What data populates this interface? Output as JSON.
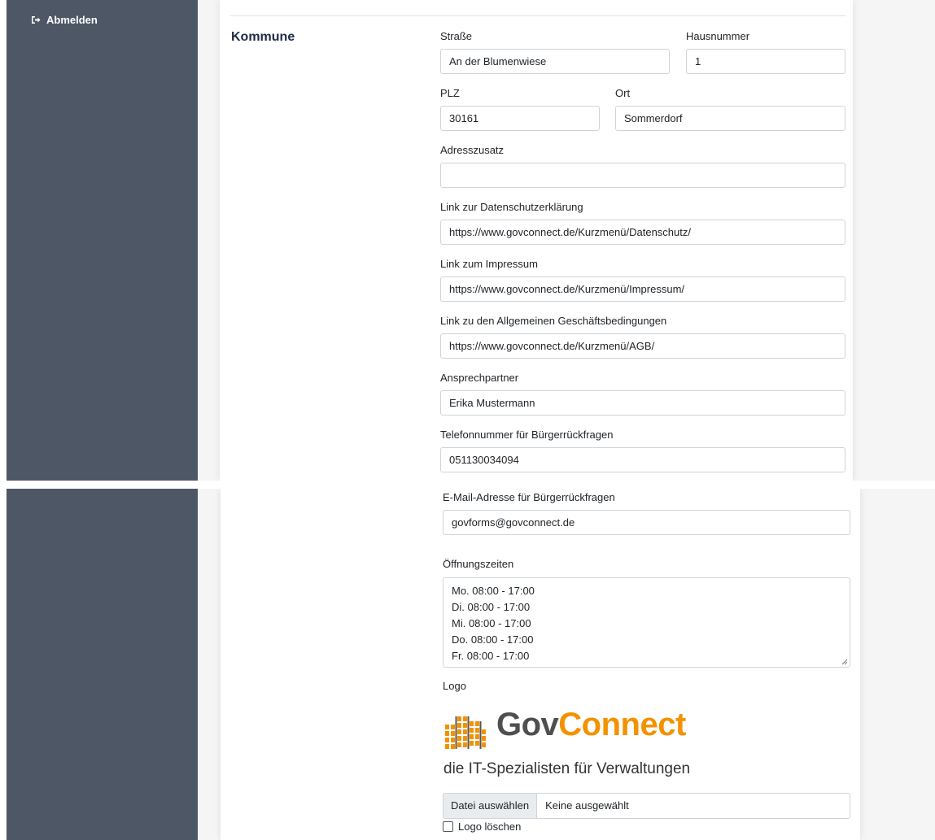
{
  "sidebar": {
    "logout_label": "Abmelden",
    "logout_icon": "sign-out-icon"
  },
  "section": {
    "title": "Kommune"
  },
  "form": {
    "street": {
      "label": "Straße",
      "value": "An der Blumenwiese"
    },
    "house_number": {
      "label": "Hausnummer",
      "value": "1"
    },
    "zip": {
      "label": "PLZ",
      "value": "30161"
    },
    "city": {
      "label": "Ort",
      "value": "Sommerdorf"
    },
    "address_extra": {
      "label": "Adresszusatz",
      "value": ""
    },
    "privacy_link": {
      "label": "Link zur Datenschutzerklärung",
      "value": "https://www.govconnect.de/Kurzmenü/Datenschutz/"
    },
    "imprint_link": {
      "label": "Link zum Impressum",
      "value": "https://www.govconnect.de/Kurzmenü/Impressum/"
    },
    "terms_link": {
      "label": "Link zu den Allgemeinen Geschäftsbedingungen",
      "value": "https://www.govconnect.de/Kurzmenü/AGB/"
    },
    "contact_person": {
      "label": "Ansprechpartner",
      "value": "Erika Mustermann"
    },
    "phone": {
      "label": "Telefonnummer für Bürgerrückfragen",
      "value": "051130034094"
    },
    "email": {
      "label": "E-Mail-Adresse für Bürgerrückfragen",
      "value": "govforms@govconnect.de"
    },
    "opening_hours": {
      "label": "Öffnungszeiten",
      "lines": [
        "Mo. 08:00 - 17:00",
        "Di. 08:00 - 17:00",
        "Mi. 08:00 - 17:00",
        "Do. 08:00 - 17:00",
        "Fr. 08:00 - 17:00"
      ]
    },
    "logo": {
      "label": "Logo",
      "brand_part1": "Gov",
      "brand_part2": "Connect",
      "tagline": "die IT-Spezialisten für Verwaltungen",
      "colors": {
        "gray": "#4f4f4f",
        "orange": "#f39200"
      }
    },
    "file": {
      "button_label": "Datei auswählen",
      "status": "Keine ausgewählt"
    },
    "delete_logo": {
      "label": "Logo löschen",
      "checked": false
    }
  },
  "colors": {
    "sidebar": "#4d5766",
    "background": "#f5f5f5",
    "title": "#1f2a44"
  }
}
